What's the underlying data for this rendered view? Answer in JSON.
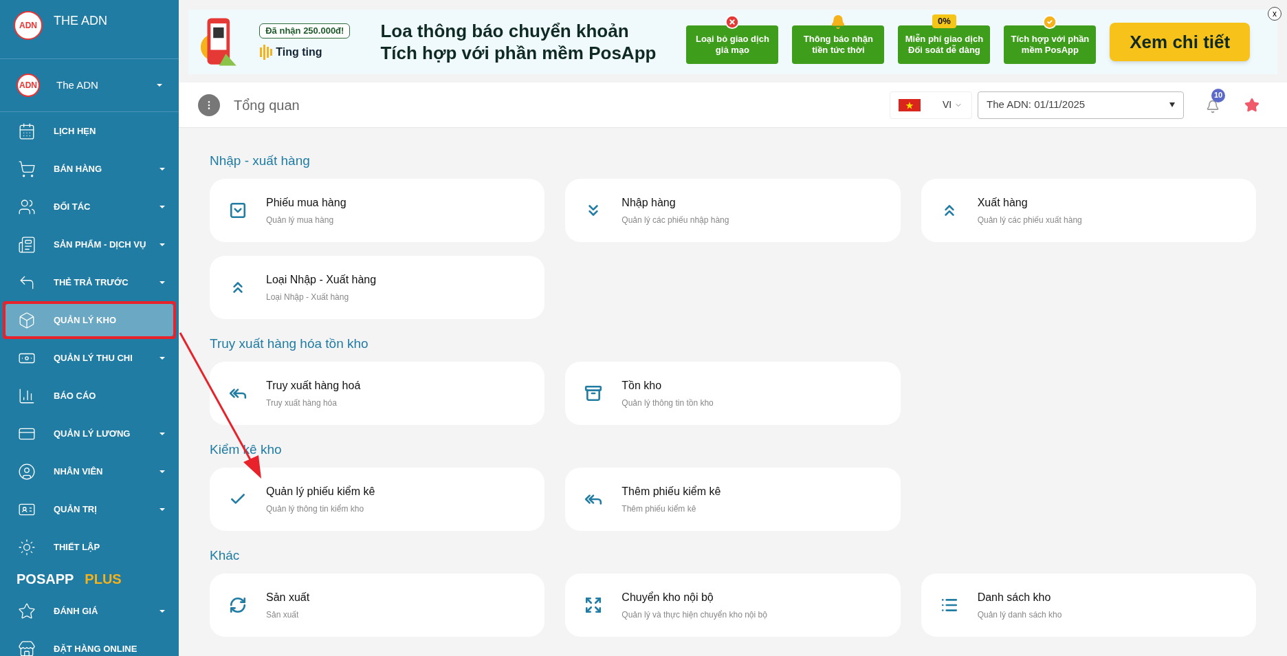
{
  "brand": {
    "title": "THE ADN",
    "logo_text": "ADN"
  },
  "account": {
    "name": "The ADN",
    "logo_text": "ADN"
  },
  "sidebar": {
    "items": [
      {
        "label": "LỊCH HẸN",
        "expandable": false,
        "selected": false
      },
      {
        "label": "BÁN HÀNG",
        "expandable": true,
        "selected": false
      },
      {
        "label": "ĐỐI TÁC",
        "expandable": true,
        "selected": false
      },
      {
        "label": "SẢN PHẨM - DỊCH VỤ",
        "expandable": true,
        "selected": false
      },
      {
        "label": "THẺ TRẢ TRƯỚC",
        "expandable": true,
        "selected": false
      },
      {
        "label": "QUẢN LÝ KHO",
        "expandable": false,
        "selected": true
      },
      {
        "label": "QUẢN LÝ THU CHI",
        "expandable": true,
        "selected": false
      },
      {
        "label": "BÁO CÁO",
        "expandable": false,
        "selected": false
      },
      {
        "label": "QUẢN LÝ LƯƠNG",
        "expandable": true,
        "selected": false
      },
      {
        "label": "NHÂN VIÊN",
        "expandable": true,
        "selected": false
      },
      {
        "label": "QUẢN TRỊ",
        "expandable": true,
        "selected": false
      },
      {
        "label": "THIẾT LẬP",
        "expandable": false,
        "selected": false
      }
    ],
    "plus_heading": [
      "POSAPP",
      "PLUS"
    ],
    "plus_items": [
      {
        "label": "ĐÁNH GIÁ",
        "expandable": true,
        "selected": false
      },
      {
        "label": "ĐẶT HÀNG ONLINE",
        "expandable": false,
        "selected": false
      }
    ]
  },
  "banner": {
    "badge": "Đã nhận 250.000đ!",
    "sound": "Ting ting",
    "headline": [
      "Loa thông báo chuyển khoản",
      "Tích hợp với phần mềm PosApp"
    ],
    "features": [
      {
        "text": "Loại bỏ giao dịch giả mạo"
      },
      {
        "text": "Thông báo nhận tiền tức thời"
      },
      {
        "text": "Miễn phí giao dịch Đối soát dễ dàng",
        "tag": "0%"
      },
      {
        "text": "Tích hợp với phần mềm PosApp"
      }
    ],
    "cta": "Xem chi tiết",
    "close": "x"
  },
  "header": {
    "title": "Tổng quan",
    "language": "VI",
    "branch_date": "The ADN: 01/11/2025",
    "notifications": "10"
  },
  "sections": [
    {
      "title": "Nhập - xuất hàng",
      "cards": [
        {
          "title": "Phiếu mua hàng",
          "subtitle": "Quản lý mua hàng"
        },
        {
          "title": "Nhập hàng",
          "subtitle": "Quản lý các phiếu nhập hàng"
        },
        {
          "title": "Xuất hàng",
          "subtitle": "Quản lý các phiếu xuất hàng"
        },
        {
          "title": "Loại Nhập - Xuất hàng",
          "subtitle": "Loại Nhập - Xuất hàng"
        }
      ]
    },
    {
      "title": "Truy xuất hàng hóa tồn kho",
      "cards": [
        {
          "title": "Truy xuất hàng hoá",
          "subtitle": "Truy xuất hàng hóa"
        },
        {
          "title": "Tồn kho",
          "subtitle": "Quản lý thông tin tồn kho"
        }
      ]
    },
    {
      "title": "Kiểm kê kho",
      "cards": [
        {
          "title": "Quản lý phiếu kiểm kê",
          "subtitle": "Quản lý thông tin kiểm kho"
        },
        {
          "title": "Thêm phiếu kiểm kê",
          "subtitle": "Thêm phiếu kiểm kê"
        }
      ]
    },
    {
      "title": "Khác",
      "cards": [
        {
          "title": "Sản xuất",
          "subtitle": "Sản xuất"
        },
        {
          "title": "Chuyển kho nội bộ",
          "subtitle": "Quản lý và thực hiện chuyển kho nội bộ"
        },
        {
          "title": "Danh sách kho",
          "subtitle": "Quản lý danh sách kho"
        }
      ]
    }
  ]
}
